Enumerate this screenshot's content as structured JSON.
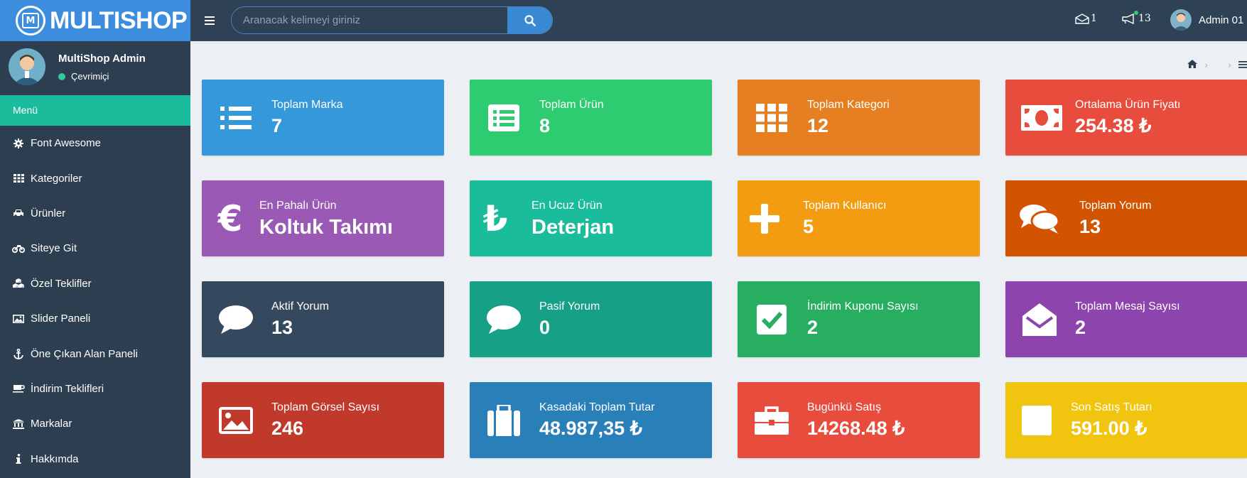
{
  "brand": {
    "name": "MULTISHOP",
    "logo_letter": "M"
  },
  "search": {
    "placeholder": "Aranacak kelimeyi giriniz",
    "value": ""
  },
  "topbar": {
    "mail_count": "1",
    "notification_count": "13",
    "user_name": "Admin 01"
  },
  "sidebar": {
    "user_name": "MultiShop Admin",
    "user_status": "Çevrimiçi",
    "menu_header": "Menü",
    "items": [
      {
        "label": "Font Awesome",
        "icon": "gear-icon"
      },
      {
        "label": "Kategoriler",
        "icon": "grid-icon"
      },
      {
        "label": "Ürünler",
        "icon": "car-icon"
      },
      {
        "label": "Siteye Git",
        "icon": "motorcycle-icon"
      },
      {
        "label": "Özel Teklifler",
        "icon": "cubes-icon"
      },
      {
        "label": "Slider Paneli",
        "icon": "image-icon"
      },
      {
        "label": "Öne Çıkan Alan Paneli",
        "icon": "anchor-icon"
      },
      {
        "label": "İndirim Teklifleri",
        "icon": "coffee-icon"
      },
      {
        "label": "Markalar",
        "icon": "bank-icon"
      },
      {
        "label": "Hakkımda",
        "icon": "info-icon"
      }
    ]
  },
  "cards": [
    {
      "label": "Toplam Marka",
      "value": "7",
      "color": "#3498db",
      "icon": "list-icon"
    },
    {
      "label": "Toplam Ürün",
      "value": "8",
      "color": "#2ecc71",
      "icon": "list-alt-icon"
    },
    {
      "label": "Toplam Kategori",
      "value": "12",
      "color": "#e67e22",
      "icon": "grid-icon"
    },
    {
      "label": "Ortalama Ürün Fiyatı",
      "value": "254.38 ₺",
      "color": "#e74c3c",
      "icon": "money-icon"
    },
    {
      "label": "En Pahalı Ürün",
      "value": "Koltuk Takımı",
      "color": "#9b59b6",
      "icon": "euro-icon"
    },
    {
      "label": "En Ucuz Ürün",
      "value": "Deterjan",
      "color": "#1abc9c",
      "icon": "lira-icon"
    },
    {
      "label": "Toplam Kullanıcı",
      "value": "5",
      "color": "#f39c12",
      "icon": "plus-icon"
    },
    {
      "label": "Toplam Yorum",
      "value": "13",
      "color": "#d35400",
      "icon": "comments-icon"
    },
    {
      "label": "Aktif Yorum",
      "value": "13",
      "color": "#34495e",
      "icon": "comment-icon"
    },
    {
      "label": "Pasif Yorum",
      "value": "0",
      "color": "#16a085",
      "icon": "comment-icon"
    },
    {
      "label": "İndirim Kuponu Sayısı",
      "value": "2",
      "color": "#27ae60",
      "icon": "check-square-icon"
    },
    {
      "label": "Toplam Mesaj Sayısı",
      "value": "2",
      "color": "#8e44ad",
      "icon": "envelope-open-icon"
    },
    {
      "label": "Toplam Görsel Sayısı",
      "value": "246",
      "color": "#c0392b",
      "icon": "picture-icon"
    },
    {
      "label": "Kasadaki Toplam Tutar",
      "value": "48.987,35 ₺",
      "color": "#2980b9",
      "icon": "suitcase-icon"
    },
    {
      "label": "Bugünkü Satış",
      "value": "14268.48 ₺",
      "color": "#e74c3c",
      "icon": "toolbox-icon"
    },
    {
      "label": "Son Satış Tutarı",
      "value": "591.00 ₺",
      "color": "#f1c40f",
      "icon": "square-icon"
    }
  ]
}
